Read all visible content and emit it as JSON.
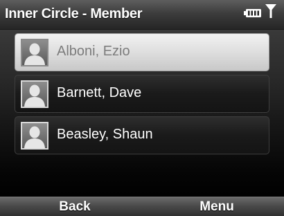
{
  "titlebar": {
    "title": "Inner Circle - Member",
    "icons": [
      "battery-icon",
      "signal-icon"
    ]
  },
  "contacts": {
    "selected_index": 0,
    "items": [
      {
        "name": "Alboni, Ezio",
        "icon": "contact-avatar-icon"
      },
      {
        "name": "Barnett, Dave",
        "icon": "contact-avatar-icon"
      },
      {
        "name": "Beasley, Shaun",
        "icon": "contact-avatar-icon"
      }
    ]
  },
  "softkeys": {
    "left_label": "Back",
    "right_label": "Menu"
  },
  "colors": {
    "selected_row": "#dcdcdc",
    "selected_text": "#7c7c7c",
    "row_text": "#ffffff"
  }
}
